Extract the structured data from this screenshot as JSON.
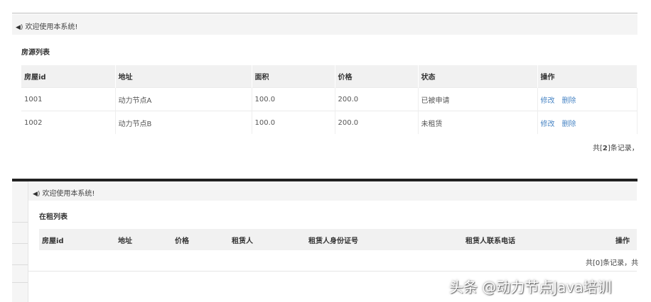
{
  "panel1": {
    "welcome": "欢迎使用本系统!",
    "title": "房源列表",
    "columns": [
      "房屋id",
      "地址",
      "面积",
      "价格",
      "状态",
      "操作"
    ],
    "rows": [
      {
        "id": "1001",
        "address": "动力节点A",
        "area": "100.0",
        "price": "200.0",
        "status": "已被申请",
        "edit": "修改",
        "delete": "删除"
      },
      {
        "id": "1002",
        "address": "动力节点B",
        "area": "100.0",
        "price": "200.0",
        "status": "未租赁",
        "edit": "修改",
        "delete": "删除"
      }
    ],
    "pager_prefix": "共[",
    "pager_count": "2",
    "pager_suffix": "]条记录，"
  },
  "panel2": {
    "welcome": "欢迎使用本系统!",
    "title": "在租列表",
    "columns": [
      "房屋id",
      "地址",
      "价格",
      "租赁人",
      "租赁人身份证号",
      "租赁人联系电话",
      "操作"
    ],
    "pager": "共[0]条记录，共"
  },
  "watermark": "头条 @动力节点Java培训",
  "icons": {
    "speaker": "speaker-icon"
  },
  "colors": {
    "link": "#4a86c5",
    "header_bg": "#f1f1f1",
    "bar_bg": "#f4f4f4"
  }
}
